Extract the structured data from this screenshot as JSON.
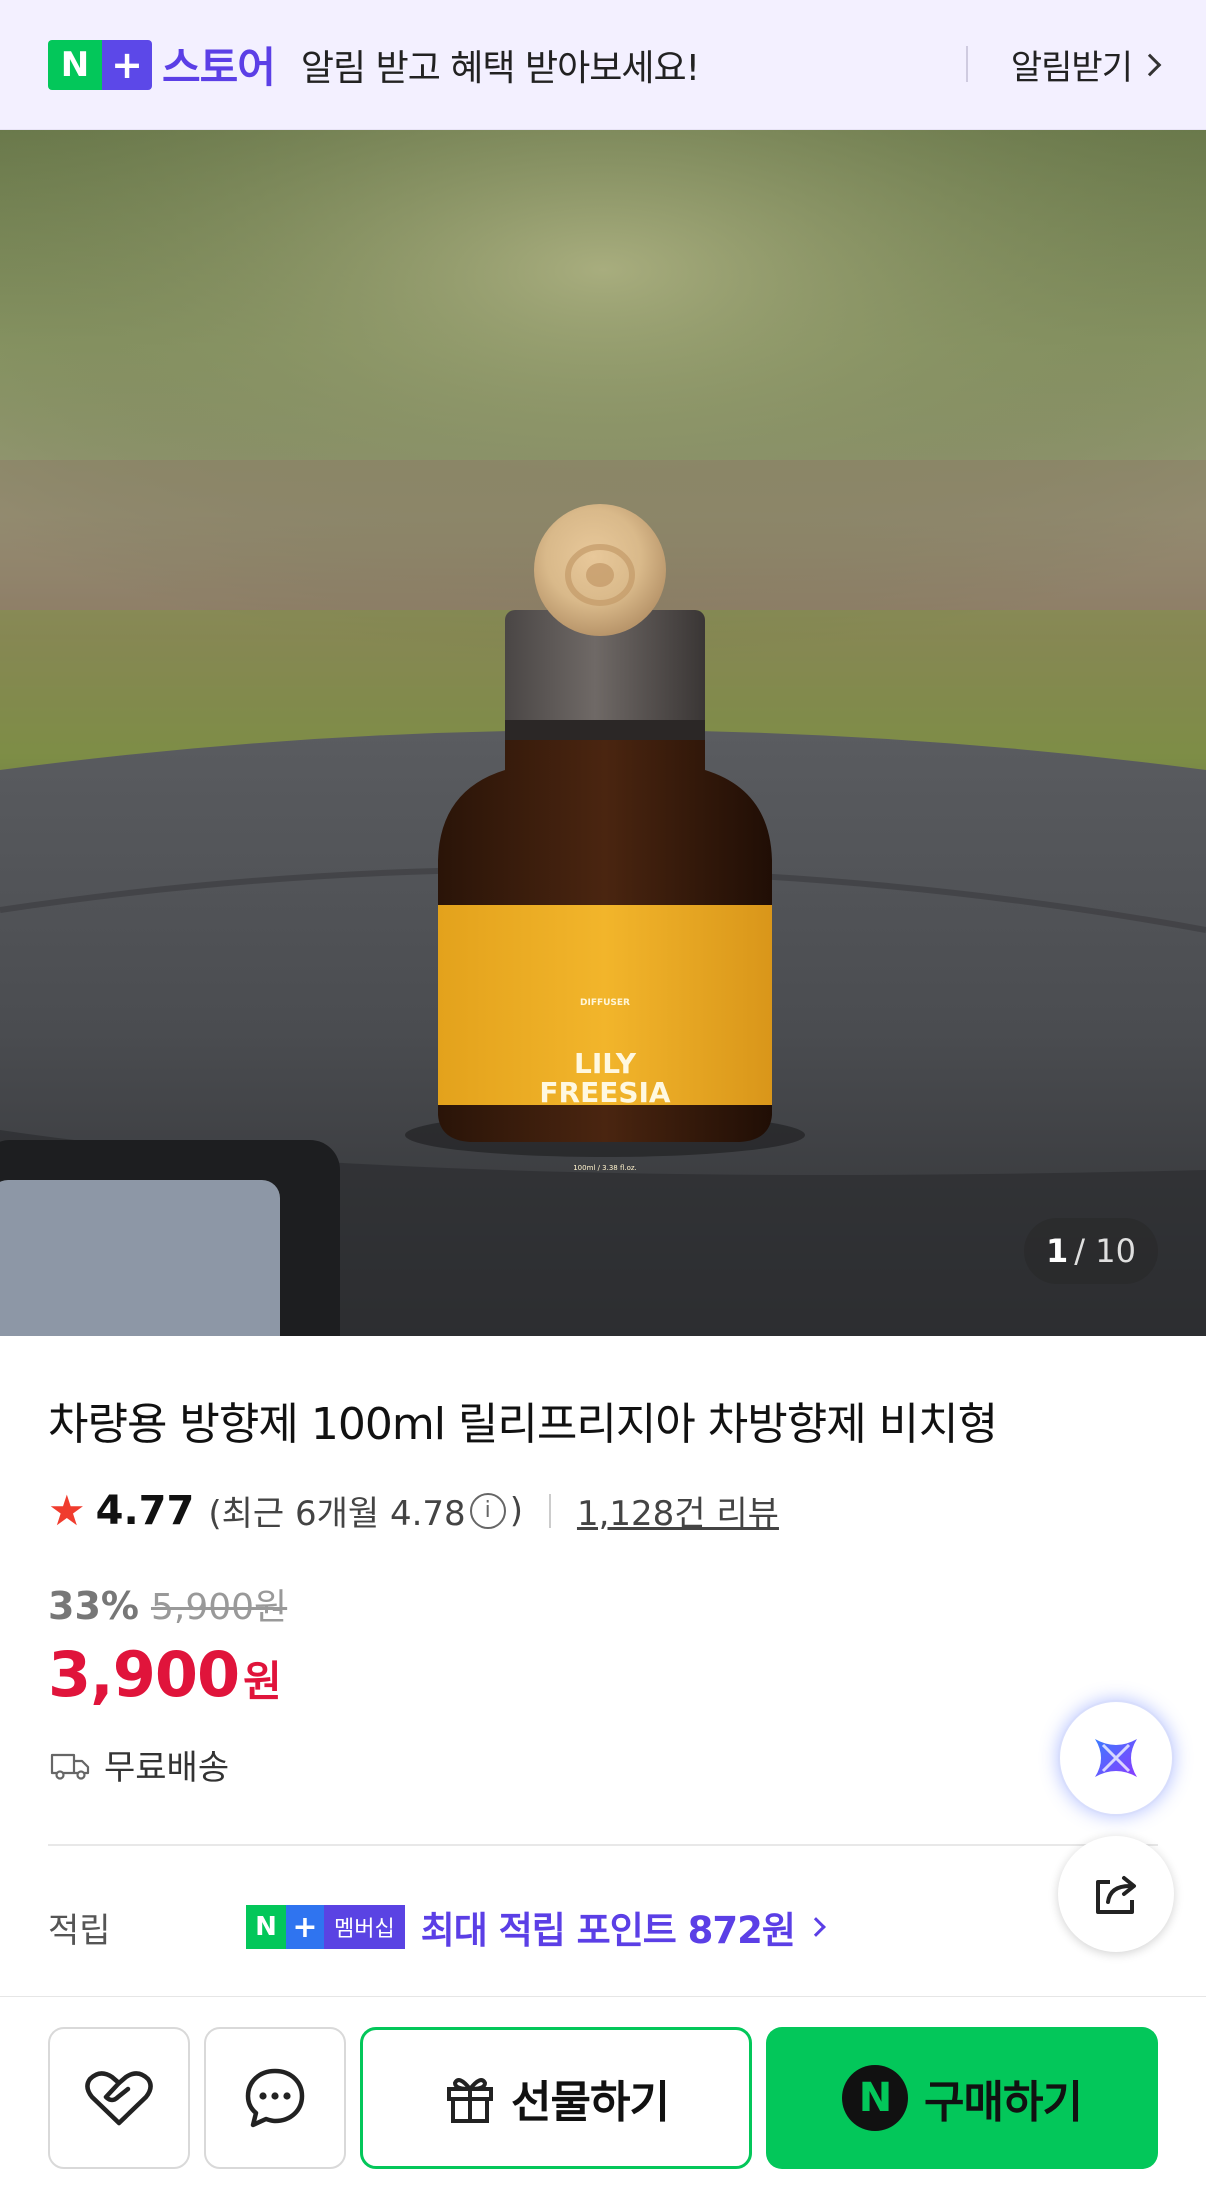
{
  "banner": {
    "logo_n": "N",
    "logo_plus": "+",
    "logo_text": "스토어",
    "message": "알림 받고 혜택 받아보세요!",
    "cta": "알림받기"
  },
  "product_image": {
    "bottle_label_top": "DIFFUSER",
    "bottle_label_line1": "LILY",
    "bottle_label_line2": "FREESIA",
    "bottle_label_bottom": "100ml / 3.38 fl.oz.",
    "counter_current": "1",
    "counter_total": "/ 10"
  },
  "product": {
    "title": "차량용 방향제 100ml 릴리프리지아 차방향제 비치형",
    "rating": "4.77",
    "recent_prefix": "(최근 6개월 4.78",
    "recent_suffix": ")",
    "info_glyph": "i",
    "review_link": "1,128건 리뷰",
    "discount_pct": "33%",
    "original_price": "5,900원",
    "price": "3,900",
    "currency": "원",
    "shipping": "무료배송"
  },
  "points": {
    "label": "적립",
    "badge_n": "N",
    "badge_plus": "+",
    "badge_text": "멤버십",
    "text": "최대 적립 포인트 872원"
  },
  "actions": {
    "gift": "선물하기",
    "buy_badge": "N",
    "buy": "구매하기"
  },
  "colors": {
    "naver_green": "#03c75a",
    "brand_purple": "#5b3fe6",
    "price_red": "#e0143b",
    "star_red": "#f03c2e"
  },
  "icons": {
    "banner_chevron": "chevron-right-icon",
    "star": "star-icon",
    "shipping": "truck-icon",
    "ai": "ai-assistant-icon",
    "share": "share-icon",
    "wishlist": "heart-icon",
    "chat": "chat-bubble-icon",
    "gift": "gift-icon"
  }
}
